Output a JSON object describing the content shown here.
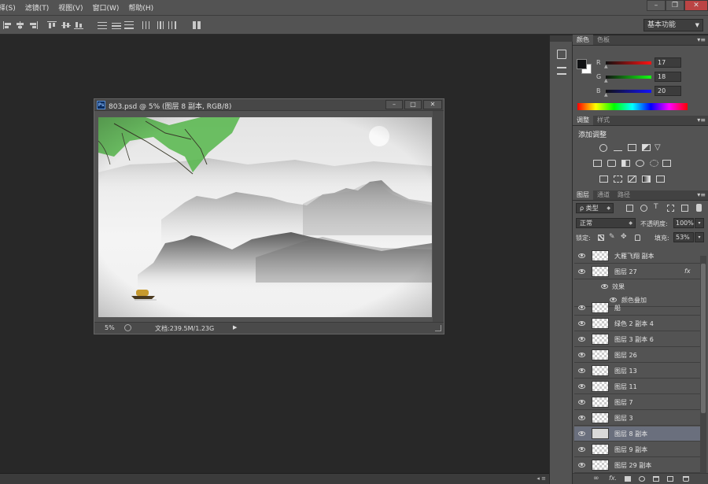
{
  "menubar": {
    "items": [
      "择(S)",
      "滤镜(T)",
      "视图(V)",
      "窗口(W)",
      "帮助(H)"
    ],
    "win_min": "–",
    "win_restore": "❐",
    "win_close": "✕"
  },
  "options": {
    "workspace": "基本功能",
    "workspace_arrow": "▼"
  },
  "document": {
    "ps_badge": "Ps",
    "title": "803.psd @ 5% (图层 8 副本, RGB/8)",
    "zoom": "5%",
    "doc_info": "文档:239.5M/1.23G",
    "btn_min": "–",
    "btn_max": "□",
    "btn_close": "✕",
    "status_arrow": "▶"
  },
  "color_panel": {
    "tabs": [
      "颜色",
      "色板"
    ],
    "r_label": "R",
    "r_value": "17",
    "g_label": "G",
    "g_value": "18",
    "b_label": "B",
    "b_value": "20",
    "foreground": "#111214",
    "background": "#ffffff"
  },
  "adjustments_panel": {
    "tabs": [
      "调整",
      "样式"
    ],
    "heading": "添加调整"
  },
  "layers_panel": {
    "tabs": [
      "图层",
      "通道",
      "路径"
    ],
    "filter_kind": "ρ 类型",
    "blend_mode": "正常",
    "opacity_label": "不透明度:",
    "opacity_value": "100%",
    "lock_label": "锁定:",
    "fill_label": "填充:",
    "fill_value": "53%",
    "fx_label": "fx",
    "effects_label": "效果",
    "effect_item": "颜色叠加",
    "layers": [
      "大雁飞翔 副本",
      "图层 27",
      "船",
      "绿色 2 副本 4",
      "图层 3 副本 6",
      "图层 26",
      "图层 13",
      "图层 11",
      "图层 7",
      "图层 3",
      "图层 8 副本",
      "图层 9 副本",
      "图层 29 副本"
    ],
    "selected_index": 10
  }
}
